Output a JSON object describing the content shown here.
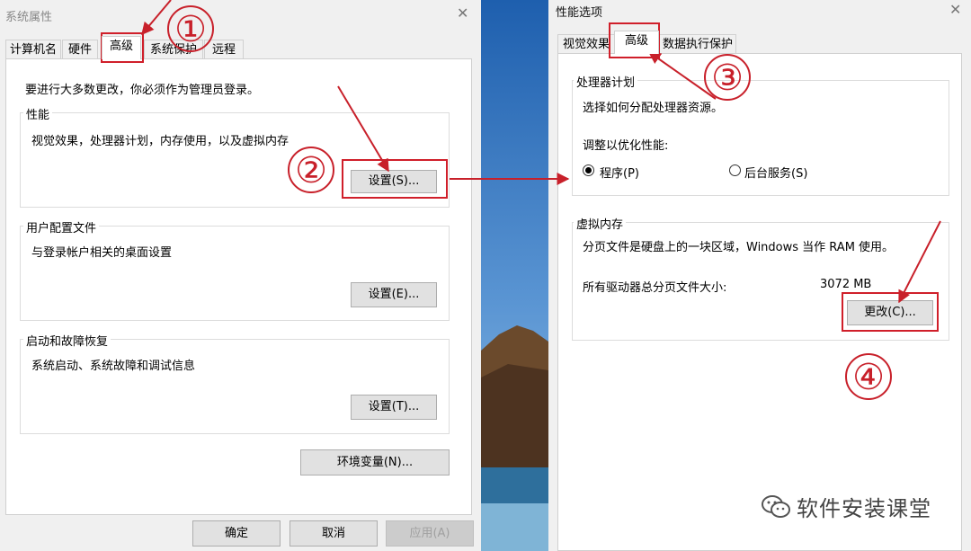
{
  "left_window": {
    "title": "系统属性",
    "tabs": [
      "计算机名",
      "硬件",
      "高级",
      "系统保护",
      "远程"
    ],
    "admin_notice": "要进行大多数更改，你必须作为管理员登录。",
    "groups": [
      {
        "label": "性能",
        "desc": "视觉效果，处理器计划，内存使用，以及虚拟内存",
        "button": "设置(S)..."
      },
      {
        "label": "用户配置文件",
        "desc": "与登录帐户相关的桌面设置",
        "button": "设置(E)..."
      },
      {
        "label": "启动和故障恢复",
        "desc": "系统启动、系统故障和调试信息",
        "button": "设置(T)..."
      }
    ],
    "env_button": "环境变量(N)...",
    "ok": "确定",
    "cancel": "取消",
    "apply": "应用(A)"
  },
  "right_window": {
    "title": "性能选项",
    "tabs": [
      "视觉效果",
      "高级",
      "数据执行保护"
    ],
    "processor": {
      "label": "处理器计划",
      "desc": "选择如何分配处理器资源。",
      "adjust_label": "调整以优化性能:",
      "option_programs": "程序(P)",
      "option_background": "后台服务(S)"
    },
    "virtual_memory": {
      "label": "虚拟内存",
      "desc": "分页文件是硬盘上的一块区域，Windows 当作 RAM 使用。",
      "total_label": "所有驱动器总分页文件大小:",
      "total_value": "3072 MB",
      "change_button": "更改(C)..."
    }
  },
  "steps": [
    "①",
    "②",
    "③",
    "④"
  ],
  "watermark": "软件安装课堂",
  "colors": {
    "annotation": "#c8202a",
    "window_bg": "#f0f0f0"
  }
}
